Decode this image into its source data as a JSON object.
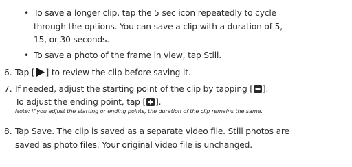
{
  "bullets": [
    {
      "lines": [
        "To save a longer clip, tap the 5 sec icon repeatedly to cycle",
        "through the options. You can save a clip with a duration of 5,",
        "15, or 30 seconds."
      ]
    },
    {
      "lines": [
        "To save a photo of the frame in view, tap Still."
      ]
    }
  ],
  "steps": {
    "step6": {
      "number": "6.",
      "before": "Tap [",
      "icon": "play-icon",
      "after": "] to review the clip before saving it."
    },
    "step7": {
      "number": "7.",
      "line1_before": "If needed, adjust the starting point of the clip by tapping [",
      "line1_icon": "minus-box-icon",
      "line1_after": "].",
      "line2_before": "To adjust the ending point, tap [",
      "line2_icon": "plus-box-icon",
      "line2_after": "].",
      "note": "Note: If you adjust the starting or ending points, the duration of the clip remains the same."
    },
    "step8": {
      "number": "8.",
      "lines": [
        "Tap Save. The clip is saved as a separate video file. Still photos are",
        "saved as photo files. Your original video file is unchanged."
      ]
    }
  },
  "colors": {
    "text": "#2a2a2a"
  }
}
